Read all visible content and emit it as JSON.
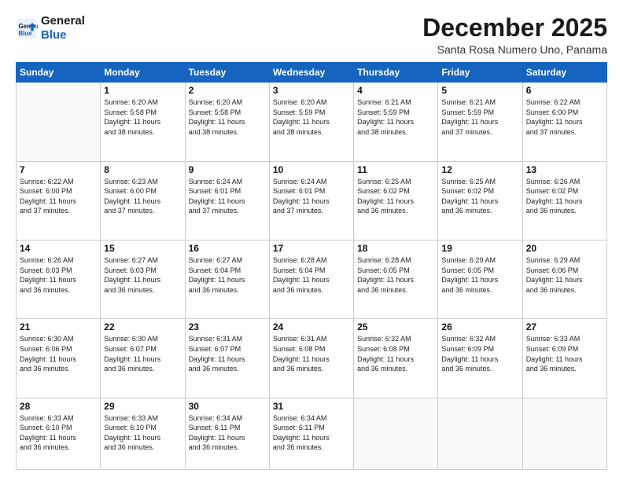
{
  "header": {
    "logo_line1": "General",
    "logo_line2": "Blue",
    "month": "December 2025",
    "location": "Santa Rosa Numero Uno, Panama"
  },
  "days_of_week": [
    "Sunday",
    "Monday",
    "Tuesday",
    "Wednesday",
    "Thursday",
    "Friday",
    "Saturday"
  ],
  "weeks": [
    [
      {
        "num": "",
        "info": ""
      },
      {
        "num": "1",
        "info": "Sunrise: 6:20 AM\nSunset: 5:58 PM\nDaylight: 11 hours\nand 38 minutes."
      },
      {
        "num": "2",
        "info": "Sunrise: 6:20 AM\nSunset: 5:58 PM\nDaylight: 11 hours\nand 38 minutes."
      },
      {
        "num": "3",
        "info": "Sunrise: 6:20 AM\nSunset: 5:59 PM\nDaylight: 11 hours\nand 38 minutes."
      },
      {
        "num": "4",
        "info": "Sunrise: 6:21 AM\nSunset: 5:59 PM\nDaylight: 11 hours\nand 38 minutes."
      },
      {
        "num": "5",
        "info": "Sunrise: 6:21 AM\nSunset: 5:59 PM\nDaylight: 11 hours\nand 37 minutes."
      },
      {
        "num": "6",
        "info": "Sunrise: 6:22 AM\nSunset: 6:00 PM\nDaylight: 11 hours\nand 37 minutes."
      }
    ],
    [
      {
        "num": "7",
        "info": "Sunrise: 6:22 AM\nSunset: 6:00 PM\nDaylight: 11 hours\nand 37 minutes."
      },
      {
        "num": "8",
        "info": "Sunrise: 6:23 AM\nSunset: 6:00 PM\nDaylight: 11 hours\nand 37 minutes."
      },
      {
        "num": "9",
        "info": "Sunrise: 6:24 AM\nSunset: 6:01 PM\nDaylight: 11 hours\nand 37 minutes."
      },
      {
        "num": "10",
        "info": "Sunrise: 6:24 AM\nSunset: 6:01 PM\nDaylight: 11 hours\nand 37 minutes."
      },
      {
        "num": "11",
        "info": "Sunrise: 6:25 AM\nSunset: 6:02 PM\nDaylight: 11 hours\nand 36 minutes."
      },
      {
        "num": "12",
        "info": "Sunrise: 6:25 AM\nSunset: 6:02 PM\nDaylight: 11 hours\nand 36 minutes."
      },
      {
        "num": "13",
        "info": "Sunrise: 6:26 AM\nSunset: 6:02 PM\nDaylight: 11 hours\nand 36 minutes."
      }
    ],
    [
      {
        "num": "14",
        "info": "Sunrise: 6:26 AM\nSunset: 6:03 PM\nDaylight: 11 hours\nand 36 minutes."
      },
      {
        "num": "15",
        "info": "Sunrise: 6:27 AM\nSunset: 6:03 PM\nDaylight: 11 hours\nand 36 minutes."
      },
      {
        "num": "16",
        "info": "Sunrise: 6:27 AM\nSunset: 6:04 PM\nDaylight: 11 hours\nand 36 minutes."
      },
      {
        "num": "17",
        "info": "Sunrise: 6:28 AM\nSunset: 6:04 PM\nDaylight: 11 hours\nand 36 minutes."
      },
      {
        "num": "18",
        "info": "Sunrise: 6:28 AM\nSunset: 6:05 PM\nDaylight: 11 hours\nand 36 minutes."
      },
      {
        "num": "19",
        "info": "Sunrise: 6:29 AM\nSunset: 6:05 PM\nDaylight: 11 hours\nand 36 minutes."
      },
      {
        "num": "20",
        "info": "Sunrise: 6:29 AM\nSunset: 6:06 PM\nDaylight: 11 hours\nand 36 minutes."
      }
    ],
    [
      {
        "num": "21",
        "info": "Sunrise: 6:30 AM\nSunset: 6:06 PM\nDaylight: 11 hours\nand 36 minutes."
      },
      {
        "num": "22",
        "info": "Sunrise: 6:30 AM\nSunset: 6:07 PM\nDaylight: 11 hours\nand 36 minutes."
      },
      {
        "num": "23",
        "info": "Sunrise: 6:31 AM\nSunset: 6:07 PM\nDaylight: 11 hours\nand 36 minutes."
      },
      {
        "num": "24",
        "info": "Sunrise: 6:31 AM\nSunset: 6:08 PM\nDaylight: 11 hours\nand 36 minutes."
      },
      {
        "num": "25",
        "info": "Sunrise: 6:32 AM\nSunset: 6:08 PM\nDaylight: 11 hours\nand 36 minutes."
      },
      {
        "num": "26",
        "info": "Sunrise: 6:32 AM\nSunset: 6:09 PM\nDaylight: 11 hours\nand 36 minutes."
      },
      {
        "num": "27",
        "info": "Sunrise: 6:33 AM\nSunset: 6:09 PM\nDaylight: 11 hours\nand 36 minutes."
      }
    ],
    [
      {
        "num": "28",
        "info": "Sunrise: 6:33 AM\nSunset: 6:10 PM\nDaylight: 11 hours\nand 36 minutes."
      },
      {
        "num": "29",
        "info": "Sunrise: 6:33 AM\nSunset: 6:10 PM\nDaylight: 11 hours\nand 36 minutes."
      },
      {
        "num": "30",
        "info": "Sunrise: 6:34 AM\nSunset: 6:11 PM\nDaylight: 11 hours\nand 36 minutes."
      },
      {
        "num": "31",
        "info": "Sunrise: 6:34 AM\nSunset: 6:11 PM\nDaylight: 11 hours\nand 36 minutes."
      },
      {
        "num": "",
        "info": ""
      },
      {
        "num": "",
        "info": ""
      },
      {
        "num": "",
        "info": ""
      }
    ]
  ]
}
